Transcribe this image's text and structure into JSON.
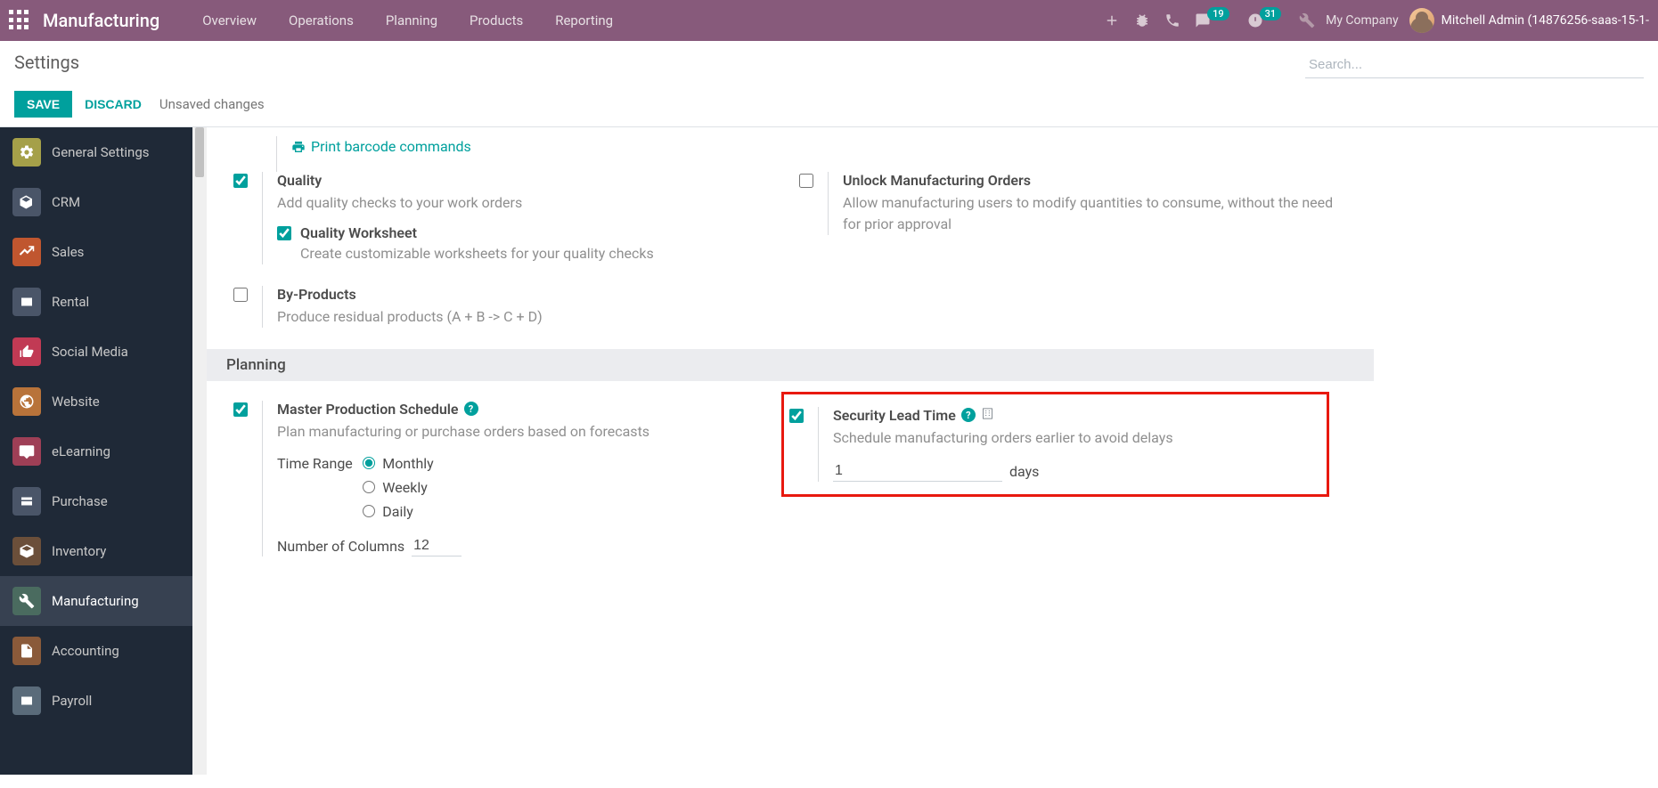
{
  "navbar": {
    "brand": "Manufacturing",
    "menu": [
      "Overview",
      "Operations",
      "Planning",
      "Products",
      "Reporting"
    ],
    "badge_messages": "19",
    "badge_activities": "31",
    "company": "My Company",
    "user": "Mitchell Admin (14876256-saas-15-1-"
  },
  "control": {
    "title": "Settings",
    "search_placeholder": "Search...",
    "save": "Save",
    "discard": "Discard",
    "status": "Unsaved changes"
  },
  "sidebar": {
    "items": [
      {
        "label": "General Settings",
        "color": "#a5a049"
      },
      {
        "label": "CRM",
        "color": "#4a5568"
      },
      {
        "label": "Sales",
        "color": "#c0562f"
      },
      {
        "label": "Rental",
        "color": "#4a5568"
      },
      {
        "label": "Social Media",
        "color": "#c13a54"
      },
      {
        "label": "Website",
        "color": "#b8733a"
      },
      {
        "label": "eLearning",
        "color": "#9e3f56"
      },
      {
        "label": "Purchase",
        "color": "#4a5568"
      },
      {
        "label": "Inventory",
        "color": "#6b4f3a"
      },
      {
        "label": "Manufacturing",
        "color": "#4a6b5f"
      },
      {
        "label": "Accounting",
        "color": "#8a5a3a"
      },
      {
        "label": "Payroll",
        "color": "#5a6b7a"
      }
    ]
  },
  "settings": {
    "print_link": "Print barcode commands",
    "quality": {
      "title": "Quality",
      "desc": "Add quality checks to your work orders",
      "worksheet_title": "Quality Worksheet",
      "worksheet_desc": "Create customizable worksheets for your quality checks"
    },
    "unlock": {
      "title": "Unlock Manufacturing Orders",
      "desc": "Allow manufacturing users to modify quantities to consume, without the need for prior approval"
    },
    "byproducts": {
      "title": "By-Products",
      "desc": "Produce residual products (A + B -> C + D)"
    },
    "section_planning": "Planning",
    "mps": {
      "title": "Master Production Schedule",
      "desc": "Plan manufacturing or purchase orders based on forecasts",
      "time_range_label": "Time Range",
      "options": {
        "monthly": "Monthly",
        "weekly": "Weekly",
        "daily": "Daily"
      },
      "num_cols_label": "Number of Columns",
      "num_cols_value": "12"
    },
    "security_lead": {
      "title": "Security Lead Time",
      "desc": "Schedule manufacturing orders earlier to avoid delays",
      "value": "1",
      "unit": "days"
    }
  }
}
